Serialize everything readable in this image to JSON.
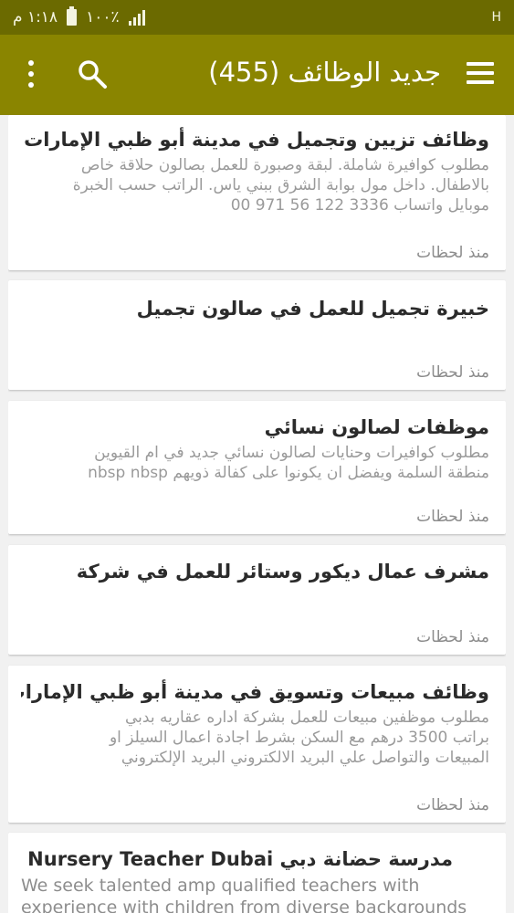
{
  "status": {
    "time": "١:١٨ م",
    "battery": "١٠٠٪",
    "extra": "H"
  },
  "toolbar": {
    "title": "جديد الوظائف (455)",
    "icons": {
      "menu": "hamburger-icon",
      "search": "search-icon",
      "more": "more-vert-icon"
    }
  },
  "colors": {
    "statusbar": "#6b6a00",
    "toolbar": "#8a8500"
  },
  "jobs": [
    {
      "title": "وظائف تزيين وتجميل في مدينة أبو ظبي الإمارات",
      "lines": [
        "مطلوب كوافيرة شاملة. لبقة وصبورة للعمل بصالون حلاقة خاص",
        "بالاطفال. داخل مول بوابة الشرق ببني ياس. الراتب حسب الخبرة",
        "موبايل واتساب 3336 122 56 971 00"
      ],
      "time": "منذ لحظات"
    },
    {
      "title": "خبيرة تجميل للعمل في صالون تجميل",
      "lines": [],
      "time": "منذ لحظات"
    },
    {
      "title": "موظفات لصالون نسائي",
      "lines": [
        "مطلوب كوافيرات وحنايات لصالون نسائي جديد في ام القيوين",
        "منطقة السلمة ويفضل ان يكونوا على كفالة ذويهم nbsp nbsp"
      ],
      "time": "منذ لحظات"
    },
    {
      "title": "مشرف عمال ديكور وستائر للعمل في شركة",
      "lines": [],
      "time": "منذ لحظات"
    },
    {
      "title": "وظائف مبيعات وتسويق في مدينة أبو ظبي الإمارات",
      "lines": [
        "مطلوب موظفين مبيعات للعمل بشركة اداره عقاريه بدبي",
        "براتب 3500 درهم مع السكن بشرط اجادة اعمال السيلز او",
        "المبيعات والتواصل علي البريد الالكتروني البريد الإلكتروني"
      ],
      "time": "منذ لحظات"
    },
    {
      "title": "مدرسة حضانة دبي Nursery Teacher Dubai",
      "lines": [
        "We seek talented amp qualified teachers with",
        "experience with children from diverse backgrounds"
      ],
      "time": ""
    }
  ]
}
